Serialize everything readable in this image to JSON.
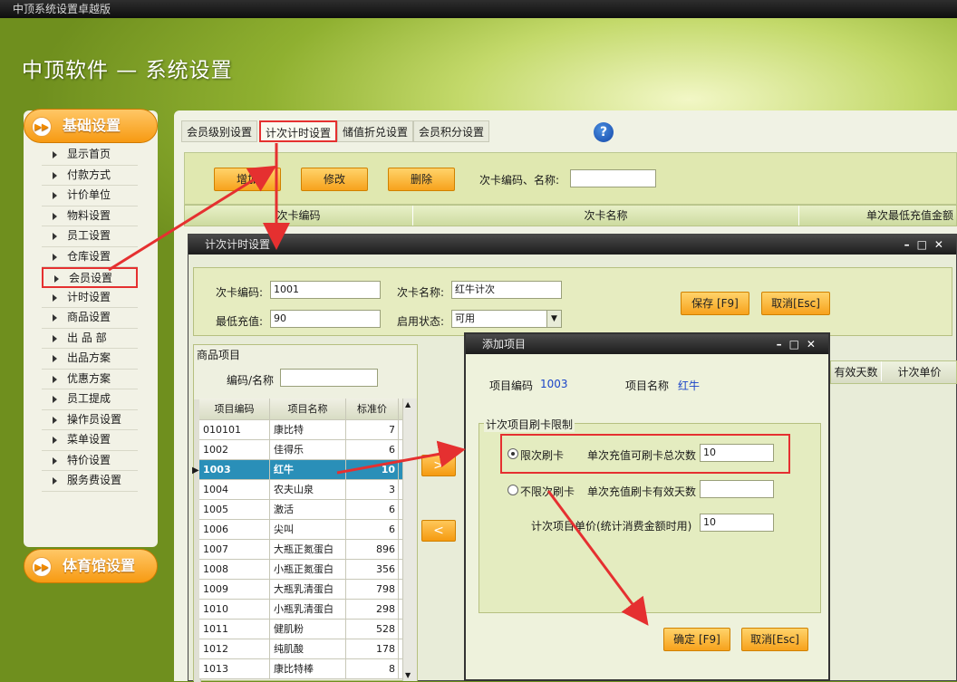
{
  "window_title": "中顶系统设置卓越版",
  "app_title": "中顶软件 — 系统设置",
  "sidebar": {
    "section1": "基础设置",
    "section2": "体育馆设置",
    "items": [
      "显示首页",
      "付款方式",
      "计价单位",
      "物料设置",
      "员工设置",
      "仓库设置",
      "会员设置",
      "计时设置",
      "商品设置",
      "出 品 部",
      "出品方案",
      "优惠方案",
      "员工提成",
      "操作员设置",
      "菜单设置",
      "特价设置",
      "服务费设置"
    ],
    "selected": "会员设置"
  },
  "tabs": [
    "会员级别设置",
    "计次计时设置",
    "储值折兑设置",
    "会员积分设置"
  ],
  "selected_tab": "计次计时设置",
  "toolbar": {
    "add": "增加",
    "edit": "修改",
    "delete": "删除",
    "search_label": "次卡编码、名称:",
    "search_value": ""
  },
  "grid_headers": [
    "次卡编码",
    "次卡名称",
    "单次最低充值金额"
  ],
  "dialog1": {
    "title": "计次计时设置",
    "card_code_label": "次卡编码:",
    "card_code": "1001",
    "card_name_label": "次卡名称:",
    "card_name": "红牛计次",
    "min_charge_label": "最低充值:",
    "min_charge": "90",
    "status_label": "启用状态:",
    "status": "可用",
    "save": "保存 [F9]",
    "cancel": "取消[Esc]",
    "products_title": "商品项目",
    "code_name_label": "编码/名称",
    "table_headers": [
      "项目编码",
      "项目名称",
      "标准价"
    ],
    "rows": [
      [
        "010101",
        "康比特",
        "7"
      ],
      [
        "1002",
        "佳得乐",
        "6"
      ],
      [
        "1003",
        "红牛",
        "10"
      ],
      [
        "1004",
        "农夫山泉",
        "3"
      ],
      [
        "1005",
        "激活",
        "6"
      ],
      [
        "1006",
        "尖叫",
        "6"
      ],
      [
        "1007",
        "大瓶正氮蛋白",
        "896"
      ],
      [
        "1008",
        "小瓶正氮蛋白",
        "356"
      ],
      [
        "1009",
        "大瓶乳清蛋白",
        "798"
      ],
      [
        "1010",
        "小瓶乳清蛋白",
        "298"
      ],
      [
        "1011",
        "健肌粉",
        "528"
      ],
      [
        "1012",
        "纯肌酸",
        "178"
      ],
      [
        "1013",
        "康比特棒",
        "8"
      ]
    ],
    "selected_row": 2,
    "right_headers": [
      "有效天数",
      "计次单价"
    ],
    "move_right": ">",
    "move_left": "<"
  },
  "dialog2": {
    "title": "添加项目",
    "item_code_label": "项目编码",
    "item_code": "1003",
    "item_name_label": "项目名称",
    "item_name": "红牛",
    "group_title": "计次项目刷卡限制",
    "limited_label": "限次刷卡",
    "limited_field_label": "单次充值可刷卡总次数",
    "limited_value": "10",
    "unlimited_label": "不限次刷卡",
    "unlimited_field_label": "单次充值刷卡有效天数",
    "unlimited_value": "",
    "price_label": "计次项目单价(统计消费金额时用)",
    "price_value": "10",
    "ok": "确定 [F9]",
    "cancel": "取消[Esc]"
  }
}
